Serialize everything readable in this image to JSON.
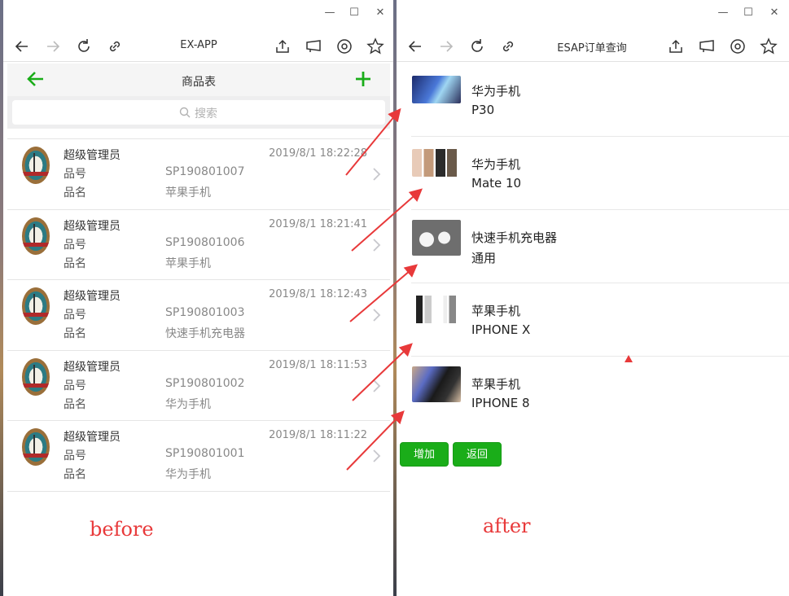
{
  "left_window": {
    "browser_title": "EX-APP",
    "app_title": "商品表",
    "search_placeholder": "搜索",
    "rows": [
      {
        "user": "超级管理员",
        "time": "2019/8/1 18:22:28",
        "label_code": "品号",
        "code": "SP190801007",
        "label_name": "品名",
        "name": "苹果手机"
      },
      {
        "user": "超级管理员",
        "time": "2019/8/1 18:21:41",
        "label_code": "品号",
        "code": "SP190801006",
        "label_name": "品名",
        "name": "苹果手机"
      },
      {
        "user": "超级管理员",
        "time": "2019/8/1 18:12:43",
        "label_code": "品号",
        "code": "SP190801003",
        "label_name": "品名",
        "name": "快速手机充电器"
      },
      {
        "user": "超级管理员",
        "time": "2019/8/1 18:11:53",
        "label_code": "品号",
        "code": "SP190801002",
        "label_name": "品名",
        "name": "华为手机"
      },
      {
        "user": "超级管理员",
        "time": "2019/8/1 18:11:22",
        "label_code": "品号",
        "code": "SP190801001",
        "label_name": "品名",
        "name": "华为手机"
      }
    ],
    "annotation": "before"
  },
  "right_window": {
    "browser_title": "ESAP订单查询",
    "products": [
      {
        "name": "华为手机",
        "model": "P30"
      },
      {
        "name": "华为手机",
        "model": "Mate 10"
      },
      {
        "name": "快速手机充电器",
        "model": "通用"
      },
      {
        "name": "苹果手机",
        "model": "IPHONE X"
      },
      {
        "name": "苹果手机",
        "model": "IPHONE 8"
      }
    ],
    "buttons": {
      "add": "增加",
      "back": "返回"
    },
    "annotation": "after"
  },
  "colors": {
    "accent_green": "#1aad19",
    "annotation_red": "#e8393a"
  }
}
